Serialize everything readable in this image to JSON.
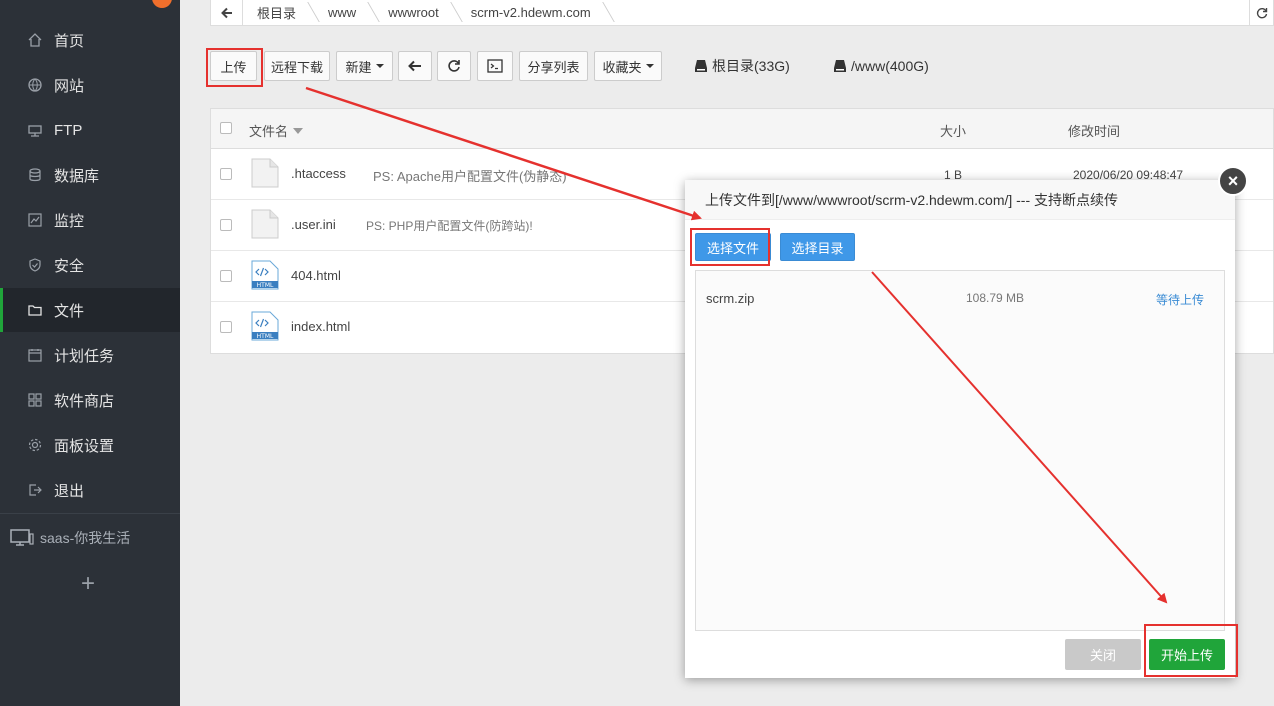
{
  "sidebar": {
    "items": [
      {
        "label": "首页",
        "icon": "home-icon"
      },
      {
        "label": "网站",
        "icon": "globe-icon"
      },
      {
        "label": "FTP",
        "icon": "ftp-icon"
      },
      {
        "label": "数据库",
        "icon": "database-icon"
      },
      {
        "label": "监控",
        "icon": "monitor-icon"
      },
      {
        "label": "安全",
        "icon": "shield-icon"
      },
      {
        "label": "文件",
        "icon": "folder-icon",
        "active": true
      },
      {
        "label": "计划任务",
        "icon": "calendar-icon"
      },
      {
        "label": "软件商店",
        "icon": "grid-icon"
      },
      {
        "label": "面板设置",
        "icon": "gear-icon"
      },
      {
        "label": "退出",
        "icon": "logout-icon"
      }
    ],
    "site_label": "saas-你我生活",
    "add_label": "+"
  },
  "breadcrumb": {
    "items": [
      "根目录",
      "www",
      "wwwroot",
      "scrm-v2.hdewm.com"
    ]
  },
  "toolbar": {
    "upload": "上传",
    "remote_download": "远程下载",
    "new": "新建",
    "share_list": "分享列表",
    "favorites": "收藏夹",
    "disk_root": "根目录(33G)",
    "disk_www": "/www(400G)"
  },
  "table": {
    "headers": {
      "name": "文件名",
      "size": "大小",
      "mtime": "修改时间"
    },
    "rows": [
      {
        "name": ".htaccess",
        "desc": "PS: Apache用户配置文件(伪静态)",
        "size": "1 B",
        "mtime": "2020/06/20 09:48:47",
        "type": "file"
      },
      {
        "name": ".user.ini",
        "desc": "PS: PHP用户配置文件(防跨站)!",
        "size": "",
        "mtime": "",
        "type": "file"
      },
      {
        "name": "404.html",
        "desc": "",
        "size": "",
        "mtime": "",
        "type": "html"
      },
      {
        "name": "index.html",
        "desc": "",
        "size": "",
        "mtime": "",
        "type": "html"
      }
    ]
  },
  "modal": {
    "title": "上传文件到[/www/wwwroot/scrm-v2.hdewm.com/] --- 支持断点续传",
    "select_file": "选择文件",
    "select_dir": "选择目录",
    "files": [
      {
        "name": "scrm.zip",
        "size": "108.79 MB",
        "status": "等待上传"
      }
    ],
    "close": "关闭",
    "start": "开始上传",
    "close_icon": "×"
  },
  "colors": {
    "sidebar_bg": "#2c3138",
    "accent_green": "#20a53a",
    "accent_blue": "#3f98e8",
    "highlight_red": "#e5312e"
  }
}
